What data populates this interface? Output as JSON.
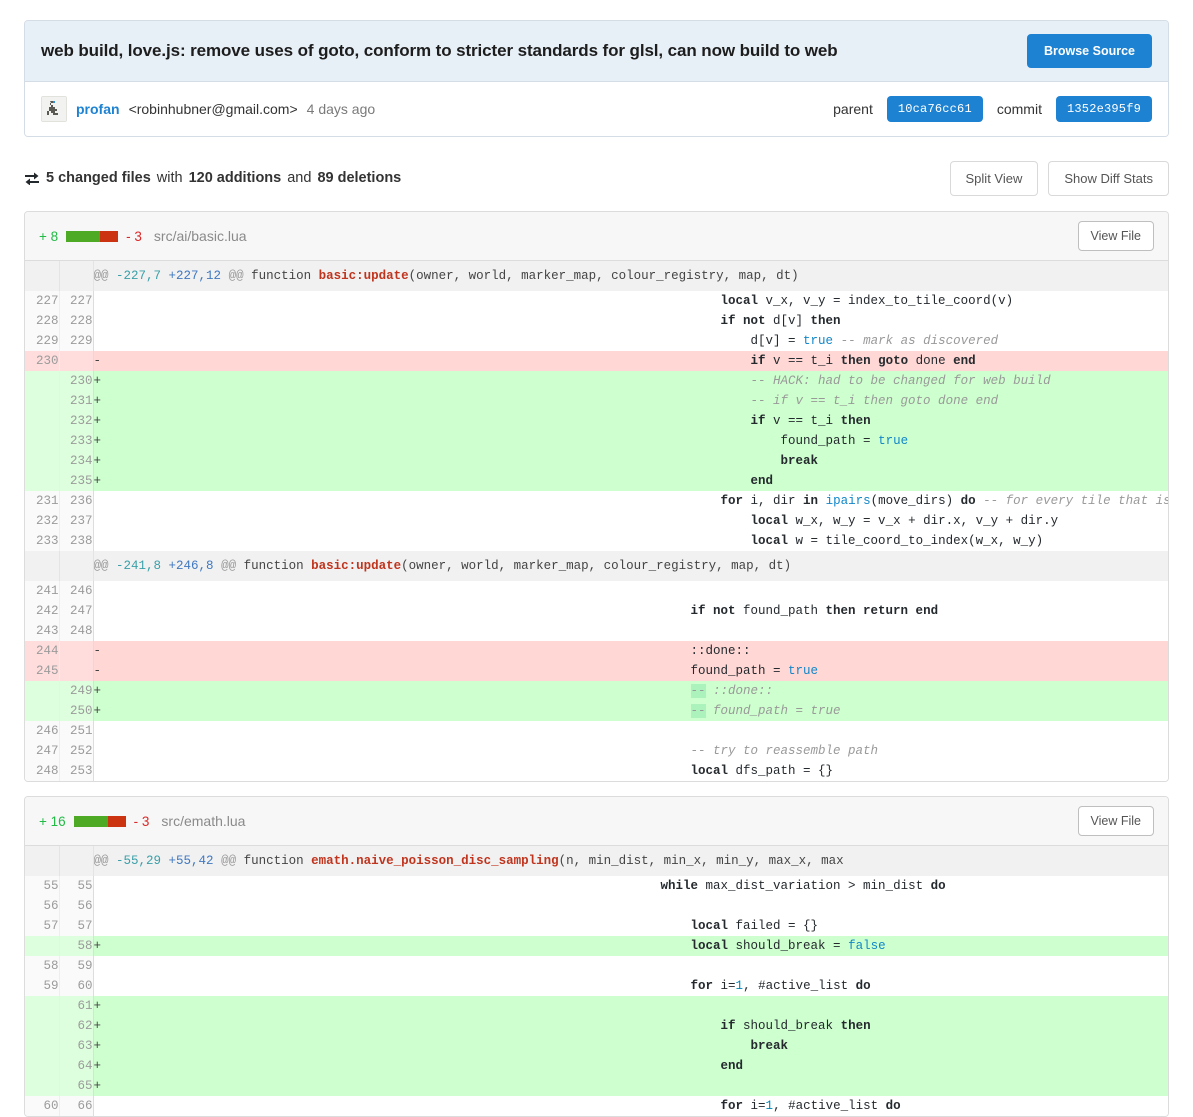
{
  "commit": {
    "title": "web build, love.js: remove uses of goto, conform to stricter standards for glsl, can now build to web",
    "browse_source_label": "Browse Source",
    "author_name": "profan",
    "author_email": "<robinhubner@gmail.com>",
    "age": "4 days ago",
    "parent_label": "parent",
    "parent_sha": "10ca76cc61",
    "commit_label": "commit",
    "commit_sha": "1352e395f9"
  },
  "summary": {
    "files_changed": "5 changed files",
    "with_word": "with",
    "additions": "120 additions",
    "and_word": "and",
    "deletions": "89 deletions",
    "split_view_label": "Split View",
    "show_diff_stats_label": "Show Diff Stats"
  },
  "colors": {
    "accent": "#1e82d2",
    "add_bg": "#ceffce",
    "del_bg": "#ffd7d5",
    "add_word": "#acf2bd",
    "stat_green": "#4eaa25",
    "stat_red": "#cc3311",
    "title_bar": "#e7eff7"
  },
  "files": [
    {
      "additions": "+ 8",
      "deletions": "- 3",
      "bar_green_pct": 66,
      "bar_red_pct": 34,
      "path": "src/ai/basic.lua",
      "view_file_label": "View File",
      "hunks": [
        {
          "header": {
            "at_open": "@@",
            "old": "-227,7",
            "new": "+227,12",
            "at_close": "@@",
            "context": " function ",
            "fn": "basic:update",
            "rest": "(owner, world, marker_map, colour_registry, map, dt)"
          },
          "rows": [
            {
              "old": "227",
              "new": "227",
              "marker": "",
              "type": "ctx",
              "tokens": [
                {
                  "t": "            ",
                  "c": "plain"
                },
                {
                  "t": "local",
                  "c": "kw"
                },
                {
                  "t": " v_x, v_y = index_to_tile_coord(v)",
                  "c": "plain"
                }
              ]
            },
            {
              "old": "228",
              "new": "228",
              "marker": "",
              "type": "ctx",
              "tokens": [
                {
                  "t": "            ",
                  "c": "plain"
                },
                {
                  "t": "if not",
                  "c": "kw"
                },
                {
                  "t": " d[v] ",
                  "c": "plain"
                },
                {
                  "t": "then",
                  "c": "kw"
                }
              ]
            },
            {
              "old": "229",
              "new": "229",
              "marker": "",
              "type": "ctx",
              "tokens": [
                {
                  "t": "                ",
                  "c": "plain"
                },
                {
                  "t": "d[v] = ",
                  "c": "plain"
                },
                {
                  "t": "true",
                  "c": "bool"
                },
                {
                  "t": " ",
                  "c": "plain"
                },
                {
                  "t": "-- mark as discovered",
                  "c": "cm"
                }
              ]
            },
            {
              "old": "230",
              "new": "",
              "marker": "-",
              "type": "del",
              "tokens": [
                {
                  "t": "                ",
                  "c": "plain"
                },
                {
                  "t": "if",
                  "c": "kw"
                },
                {
                  "t": " v == t_i ",
                  "c": "plain"
                },
                {
                  "t": "then goto",
                  "c": "kw"
                },
                {
                  "t": " done ",
                  "c": "plain"
                },
                {
                  "t": "end",
                  "c": "kw"
                }
              ]
            },
            {
              "old": "",
              "new": "230",
              "marker": "+",
              "type": "add",
              "tokens": [
                {
                  "t": "                ",
                  "c": "plain"
                },
                {
                  "t": "-- HACK: had to be changed for web build",
                  "c": "cm"
                }
              ]
            },
            {
              "old": "",
              "new": "231",
              "marker": "+",
              "type": "add",
              "tokens": [
                {
                  "t": "                ",
                  "c": "plain"
                },
                {
                  "t": "-- if v == t_i then goto done end",
                  "c": "cm"
                }
              ]
            },
            {
              "old": "",
              "new": "232",
              "marker": "+",
              "type": "add",
              "tokens": [
                {
                  "t": "                ",
                  "c": "plain"
                },
                {
                  "t": "if",
                  "c": "kw"
                },
                {
                  "t": " v == t_i ",
                  "c": "plain"
                },
                {
                  "t": "then",
                  "c": "kw"
                }
              ]
            },
            {
              "old": "",
              "new": "233",
              "marker": "+",
              "type": "add",
              "tokens": [
                {
                  "t": "                    ",
                  "c": "plain"
                },
                {
                  "t": "found_path = ",
                  "c": "plain"
                },
                {
                  "t": "true",
                  "c": "bool"
                }
              ]
            },
            {
              "old": "",
              "new": "234",
              "marker": "+",
              "type": "add",
              "tokens": [
                {
                  "t": "                    ",
                  "c": "plain"
                },
                {
                  "t": "break",
                  "c": "kw"
                }
              ]
            },
            {
              "old": "",
              "new": "235",
              "marker": "+",
              "type": "add",
              "tokens": [
                {
                  "t": "                ",
                  "c": "plain"
                },
                {
                  "t": "end",
                  "c": "kw"
                }
              ]
            },
            {
              "old": "231",
              "new": "236",
              "marker": "",
              "type": "ctx",
              "tokens": [
                {
                  "t": "            ",
                  "c": "plain"
                },
                {
                  "t": "for",
                  "c": "kw"
                },
                {
                  "t": " i, dir ",
                  "c": "plain"
                },
                {
                  "t": "in",
                  "c": "kw"
                },
                {
                  "t": " ",
                  "c": "plain"
                },
                {
                  "t": "ipairs",
                  "c": "fn"
                },
                {
                  "t": "(move_dirs) ",
                  "c": "plain"
                },
                {
                  "t": "do",
                  "c": "kw"
                },
                {
                  "t": " ",
                  "c": "plain"
                },
                {
                  "t": "-- for every tile that is reachable from this one",
                  "c": "cm"
                }
              ]
            },
            {
              "old": "232",
              "new": "237",
              "marker": "",
              "type": "ctx",
              "tokens": [
                {
                  "t": "                ",
                  "c": "plain"
                },
                {
                  "t": "local",
                  "c": "kw"
                },
                {
                  "t": " w_x, w_y = v_x + dir.x, v_y + dir.y",
                  "c": "plain"
                }
              ]
            },
            {
              "old": "233",
              "new": "238",
              "marker": "",
              "type": "ctx",
              "tokens": [
                {
                  "t": "                ",
                  "c": "plain"
                },
                {
                  "t": "local",
                  "c": "kw"
                },
                {
                  "t": " w = tile_coord_to_index(w_x, w_y)",
                  "c": "plain"
                }
              ]
            }
          ]
        },
        {
          "header": {
            "at_open": "@@",
            "old": "-241,8",
            "new": "+246,8",
            "at_close": "@@",
            "context": " function ",
            "fn": "basic:update",
            "rest": "(owner, world, marker_map, colour_registry, map, dt)"
          },
          "rows": [
            {
              "old": "241",
              "new": "246",
              "marker": "",
              "type": "ctx",
              "tokens": [
                {
                  "t": "",
                  "c": "plain"
                }
              ]
            },
            {
              "old": "242",
              "new": "247",
              "marker": "",
              "type": "ctx",
              "tokens": [
                {
                  "t": "        ",
                  "c": "plain"
                },
                {
                  "t": "if not",
                  "c": "kw"
                },
                {
                  "t": " found_path ",
                  "c": "plain"
                },
                {
                  "t": "then return end",
                  "c": "kw"
                }
              ]
            },
            {
              "old": "243",
              "new": "248",
              "marker": "",
              "type": "ctx",
              "tokens": [
                {
                  "t": "",
                  "c": "plain"
                }
              ]
            },
            {
              "old": "244",
              "new": "",
              "marker": "-",
              "type": "del",
              "tokens": [
                {
                  "t": "        ",
                  "c": "plain"
                },
                {
                  "t": "::done::",
                  "c": "plain"
                }
              ]
            },
            {
              "old": "245",
              "new": "",
              "marker": "-",
              "type": "del",
              "tokens": [
                {
                  "t": "        ",
                  "c": "plain"
                },
                {
                  "t": "found_path = ",
                  "c": "plain"
                },
                {
                  "t": "true",
                  "c": "bool"
                }
              ]
            },
            {
              "old": "",
              "new": "249",
              "marker": "+",
              "type": "add",
              "tokens": [
                {
                  "t": "        ",
                  "c": "plain"
                },
                {
                  "t": "--",
                  "c": "cm wd"
                },
                {
                  "t": " ::done::",
                  "c": "cm"
                }
              ]
            },
            {
              "old": "",
              "new": "250",
              "marker": "+",
              "type": "add",
              "tokens": [
                {
                  "t": "        ",
                  "c": "plain"
                },
                {
                  "t": "--",
                  "c": "cm wd"
                },
                {
                  "t": " found_path = true",
                  "c": "cm"
                }
              ]
            },
            {
              "old": "246",
              "new": "251",
              "marker": "",
              "type": "ctx",
              "tokens": [
                {
                  "t": "",
                  "c": "plain"
                }
              ]
            },
            {
              "old": "247",
              "new": "252",
              "marker": "",
              "type": "ctx",
              "tokens": [
                {
                  "t": "        ",
                  "c": "plain"
                },
                {
                  "t": "-- try to reassemble path",
                  "c": "cm"
                }
              ]
            },
            {
              "old": "248",
              "new": "253",
              "marker": "",
              "type": "ctx",
              "tokens": [
                {
                  "t": "        ",
                  "c": "plain"
                },
                {
                  "t": "local",
                  "c": "kw"
                },
                {
                  "t": " dfs_path = {}",
                  "c": "plain"
                }
              ]
            }
          ]
        }
      ]
    },
    {
      "additions": "+ 16",
      "deletions": "- 3",
      "bar_green_pct": 66,
      "bar_red_pct": 34,
      "path": "src/emath.lua",
      "view_file_label": "View File",
      "hunks": [
        {
          "header": {
            "at_open": "@@",
            "old": "-55,29",
            "new": "+55,42",
            "at_close": "@@",
            "context": " function ",
            "fn": "emath.naive_poisson_disc_sampling",
            "rest": "(n, min_dist, min_x, min_y, max_x, max"
          },
          "rows": [
            {
              "old": "55",
              "new": "55",
              "marker": "",
              "type": "ctx",
              "tokens": [
                {
                  "t": "    ",
                  "c": "plain"
                },
                {
                  "t": "while",
                  "c": "kw"
                },
                {
                  "t": " max_dist_variation > min_dist ",
                  "c": "plain"
                },
                {
                  "t": "do",
                  "c": "kw"
                }
              ]
            },
            {
              "old": "56",
              "new": "56",
              "marker": "",
              "type": "ctx",
              "tokens": [
                {
                  "t": "",
                  "c": "plain"
                }
              ]
            },
            {
              "old": "57",
              "new": "57",
              "marker": "",
              "type": "ctx",
              "tokens": [
                {
                  "t": "        ",
                  "c": "plain"
                },
                {
                  "t": "local",
                  "c": "kw"
                },
                {
                  "t": " failed = {}",
                  "c": "plain"
                }
              ]
            },
            {
              "old": "",
              "new": "58",
              "marker": "+",
              "type": "add",
              "tokens": [
                {
                  "t": "        ",
                  "c": "plain"
                },
                {
                  "t": "local",
                  "c": "kw"
                },
                {
                  "t": " should_break = ",
                  "c": "plain"
                },
                {
                  "t": "false",
                  "c": "bool"
                }
              ]
            },
            {
              "old": "58",
              "new": "59",
              "marker": "",
              "type": "ctx",
              "tokens": [
                {
                  "t": "",
                  "c": "plain"
                }
              ]
            },
            {
              "old": "59",
              "new": "60",
              "marker": "",
              "type": "ctx",
              "tokens": [
                {
                  "t": "        ",
                  "c": "plain"
                },
                {
                  "t": "for",
                  "c": "kw"
                },
                {
                  "t": " i=",
                  "c": "plain"
                },
                {
                  "t": "1",
                  "c": "num"
                },
                {
                  "t": ", #active_list ",
                  "c": "plain"
                },
                {
                  "t": "do",
                  "c": "kw"
                }
              ]
            },
            {
              "old": "",
              "new": "61",
              "marker": "+",
              "type": "add",
              "tokens": [
                {
                  "t": "",
                  "c": "plain"
                }
              ]
            },
            {
              "old": "",
              "new": "62",
              "marker": "+",
              "type": "add",
              "tokens": [
                {
                  "t": "            ",
                  "c": "plain"
                },
                {
                  "t": "if",
                  "c": "kw"
                },
                {
                  "t": " should_break ",
                  "c": "plain"
                },
                {
                  "t": "then",
                  "c": "kw"
                }
              ]
            },
            {
              "old": "",
              "new": "63",
              "marker": "+",
              "type": "add",
              "tokens": [
                {
                  "t": "                ",
                  "c": "plain"
                },
                {
                  "t": "break",
                  "c": "kw"
                }
              ]
            },
            {
              "old": "",
              "new": "64",
              "marker": "+",
              "type": "add",
              "tokens": [
                {
                  "t": "            ",
                  "c": "plain"
                },
                {
                  "t": "end",
                  "c": "kw"
                }
              ]
            },
            {
              "old": "",
              "new": "65",
              "marker": "+",
              "type": "add",
              "tokens": [
                {
                  "t": "",
                  "c": "plain"
                }
              ]
            },
            {
              "old": "60",
              "new": "66",
              "marker": "",
              "type": "ctx",
              "tokens": [
                {
                  "t": "            ",
                  "c": "plain"
                },
                {
                  "t": "for",
                  "c": "kw"
                },
                {
                  "t": " i=",
                  "c": "plain"
                },
                {
                  "t": "1",
                  "c": "num"
                },
                {
                  "t": ", #active_list ",
                  "c": "plain"
                },
                {
                  "t": "do",
                  "c": "kw"
                }
              ]
            }
          ]
        }
      ]
    }
  ]
}
